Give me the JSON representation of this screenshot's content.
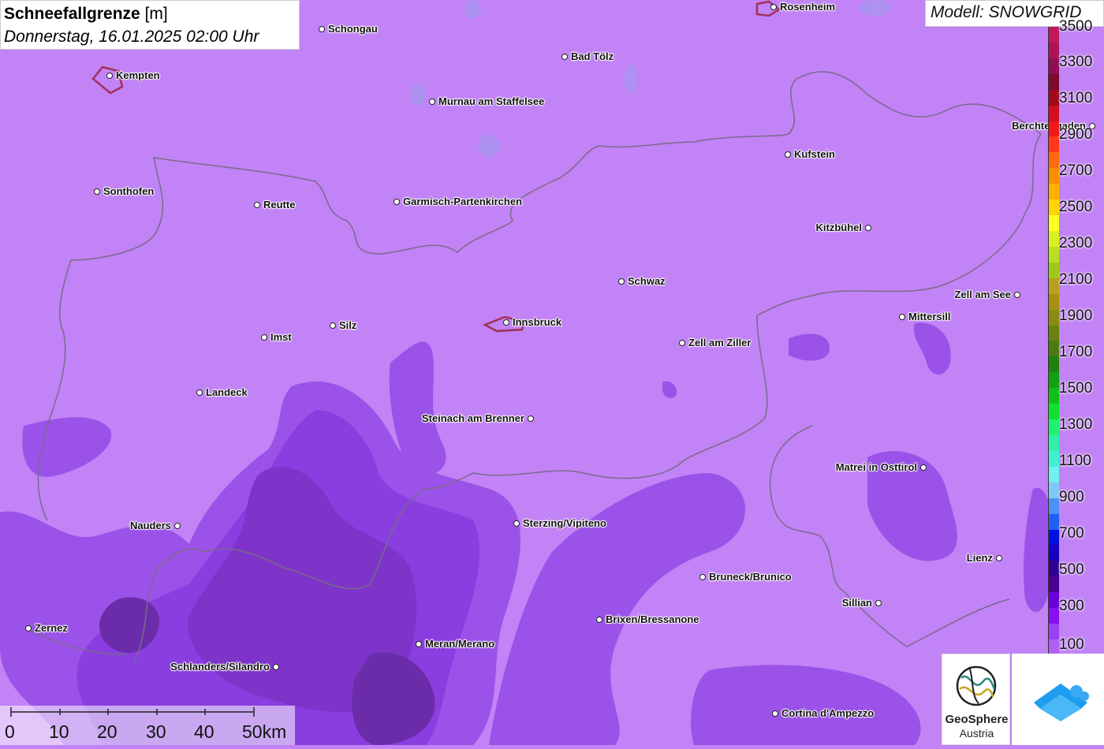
{
  "title": {
    "main": "Schneefallgrenze",
    "unit": "[m]",
    "datetime": "Donnerstag, 16.01.2025 02:00 Uhr"
  },
  "model": "Modell: SNOWGRID",
  "legend": {
    "labels": [
      "3500",
      "3300",
      "3100",
      "2900",
      "2700",
      "2500",
      "2300",
      "2100",
      "1900",
      "1700",
      "1500",
      "1300",
      "1100",
      "900",
      "700",
      "500",
      "300",
      "100"
    ],
    "colors": [
      "#c2185b",
      "#ad1457",
      "#8e0e55",
      "#7a0b2e",
      "#a1081c",
      "#d01020",
      "#f01818",
      "#ff3a1a",
      "#ff6a10",
      "#ff8c00",
      "#ffb000",
      "#ffd400",
      "#ffff20",
      "#d8f020",
      "#b8e020",
      "#a0c818",
      "#b8a020",
      "#a89010",
      "#8a8a10",
      "#6a8010",
      "#4a7a10",
      "#208010",
      "#10a010",
      "#10c018",
      "#10e030",
      "#20f070",
      "#30f0a8",
      "#40f0d0",
      "#70f0f0",
      "#80c8f8",
      "#5090f8",
      "#2060f0",
      "#0010e0",
      "#1800c0",
      "#300090",
      "#480090",
      "#6a00d8",
      "#8810f0",
      "#9a40f0",
      "#b060f2"
    ]
  },
  "scale": {
    "labels": [
      "0",
      "10",
      "20",
      "30",
      "40",
      "50km"
    ]
  },
  "cities": [
    {
      "name": "Rosenheim",
      "side": "r"
    },
    {
      "name": "Schongau",
      "side": "r"
    },
    {
      "name": "Kempten",
      "side": "r"
    },
    {
      "name": "Bad Tölz",
      "side": "r"
    },
    {
      "name": "Murnau am Staffelsee",
      "side": "r"
    },
    {
      "name": "Berchtesgaden",
      "side": "l"
    },
    {
      "name": "Kufstein",
      "side": "r"
    },
    {
      "name": "Sonthofen",
      "side": "r"
    },
    {
      "name": "Reutte",
      "side": "r"
    },
    {
      "name": "Garmisch-Partenkirchen",
      "side": "r"
    },
    {
      "name": "Kitzbühel",
      "side": "l"
    },
    {
      "name": "Schwaz",
      "side": "r"
    },
    {
      "name": "Zell am See",
      "side": "l"
    },
    {
      "name": "Mittersill",
      "side": "r"
    },
    {
      "name": "Innsbruck",
      "side": "r"
    },
    {
      "name": "Silz",
      "side": "r"
    },
    {
      "name": "Imst",
      "side": "r"
    },
    {
      "name": "Zell am Ziller",
      "side": "r"
    },
    {
      "name": "Landeck",
      "side": "r"
    },
    {
      "name": "Steinach am Brenner",
      "side": "l"
    },
    {
      "name": "Matrei in Osttirol",
      "side": "l"
    },
    {
      "name": "Nauders",
      "side": "l"
    },
    {
      "name": "Sterzing/Vipiteno",
      "side": "r"
    },
    {
      "name": "Lienz",
      "side": "l"
    },
    {
      "name": "Bruneck/Brunico",
      "side": "r"
    },
    {
      "name": "Sillian",
      "side": "l"
    },
    {
      "name": "Brixen/Bressanone",
      "side": "r"
    },
    {
      "name": "Zernez",
      "side": "r"
    },
    {
      "name": "Meran/Merano",
      "side": "r"
    },
    {
      "name": "Schlanders/Silandro",
      "side": "l"
    },
    {
      "name": "Cortina d'Ampezzo",
      "side": "r"
    }
  ],
  "logos": {
    "geosphere_line1": "GeoSphere",
    "geosphere_line2": "Austria"
  }
}
